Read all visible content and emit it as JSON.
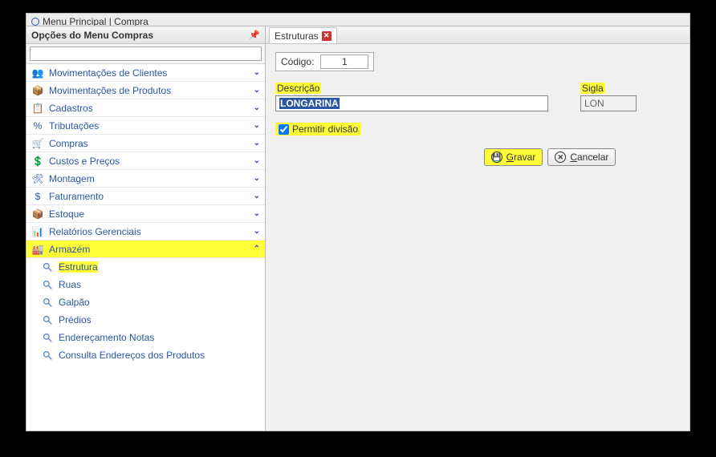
{
  "topStub": {
    "text": "Menu Principal   |   Compra"
  },
  "sidebar": {
    "title": "Opções do Menu Compras",
    "searchValue": "",
    "items": [
      {
        "icon": "👥",
        "label": "Movimentações de Clientes"
      },
      {
        "icon": "📦",
        "label": "Movimentações de Produtos"
      },
      {
        "icon": "📋",
        "label": "Cadastros"
      },
      {
        "icon": "%",
        "label": "Tributações"
      },
      {
        "icon": "🛒",
        "label": "Compras"
      },
      {
        "icon": "💲",
        "label": "Custos e Preços"
      },
      {
        "icon": "🛠",
        "label": "Montagem"
      },
      {
        "icon": "$",
        "label": "Faturamento"
      },
      {
        "icon": "📦",
        "label": "Estoque"
      },
      {
        "icon": "📊",
        "label": "Relatórios Gerenciais"
      }
    ],
    "expanded": {
      "icon": "🏭",
      "label": "Armazém",
      "subitems": [
        {
          "label": "Estrutura",
          "hl": true
        },
        {
          "label": "Ruas"
        },
        {
          "label": "Galpão"
        },
        {
          "label": "Prédios"
        },
        {
          "label": "Endereçamento Notas"
        },
        {
          "label": "Consulta Endereços dos Produtos"
        }
      ]
    }
  },
  "main": {
    "tab": {
      "label": "Estruturas"
    },
    "codigo": {
      "label": "Código:",
      "value": "1"
    },
    "descricao": {
      "label": "Descrição",
      "value": "LONGARINA"
    },
    "sigla": {
      "label": "Sigla",
      "value": "LON"
    },
    "permitir": {
      "label": "Permitir divisão",
      "checked": true
    },
    "buttons": {
      "gravar": "Gravar",
      "cancelar": "Cancelar"
    }
  }
}
